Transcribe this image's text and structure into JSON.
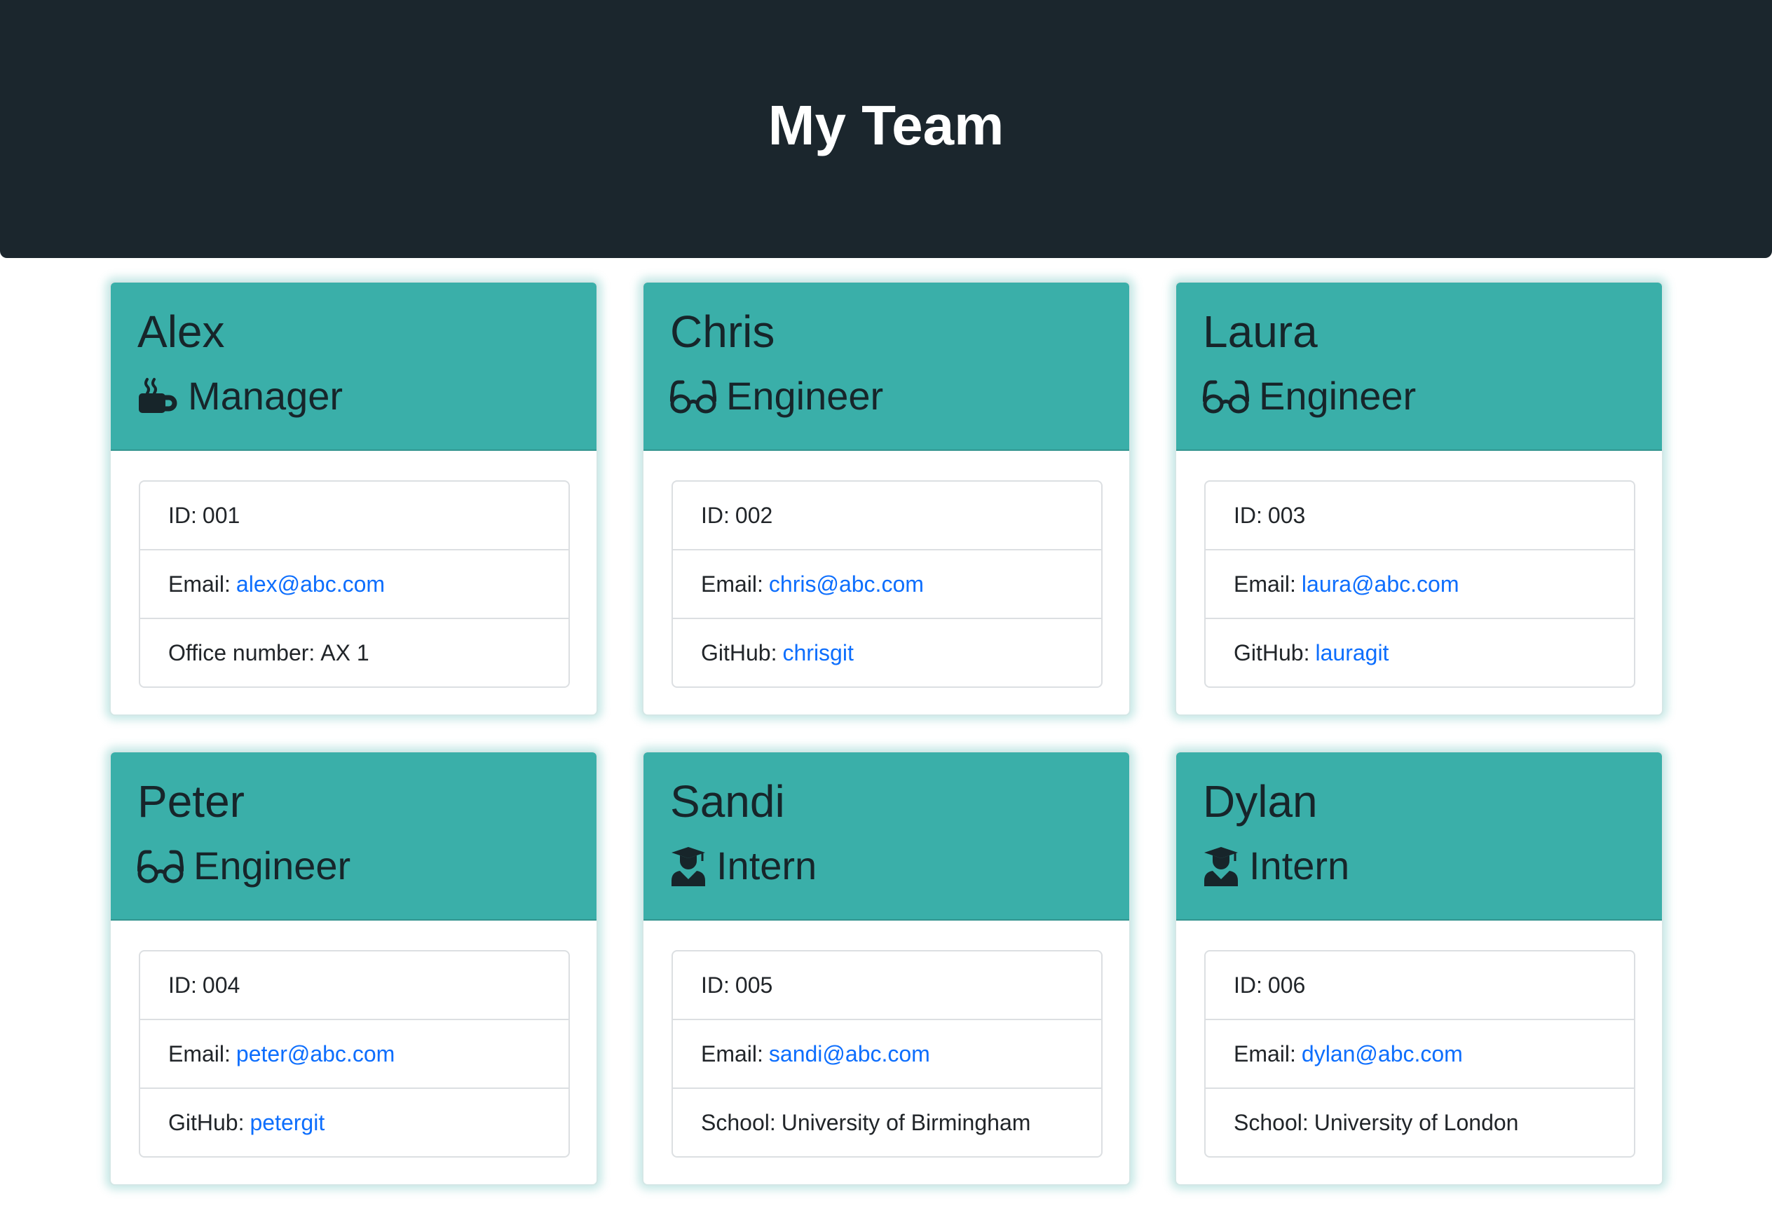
{
  "header": {
    "title": "My Team"
  },
  "colors": {
    "header_bg": "#1b262d",
    "card_head_bg": "#3aafa9",
    "link": "#0d6efd"
  },
  "cards": [
    {
      "name": "Alex",
      "role": "Manager",
      "role_icon": "coffee-mug-icon",
      "id_label": "ID:",
      "id": "001",
      "email_label": "Email:",
      "email": "alex@abc.com",
      "extra_label": "Office number:",
      "extra": "AX 1"
    },
    {
      "name": "Chris",
      "role": "Engineer",
      "role_icon": "glasses-icon",
      "id_label": "ID:",
      "id": "002",
      "email_label": "Email:",
      "email": "chris@abc.com",
      "extra_label": "GitHub:",
      "extra": "chrisgit"
    },
    {
      "name": "Laura",
      "role": "Engineer",
      "role_icon": "glasses-icon",
      "id_label": "ID:",
      "id": "003",
      "email_label": "Email:",
      "email": "laura@abc.com",
      "extra_label": "GitHub:",
      "extra": "lauragit"
    },
    {
      "name": "Peter",
      "role": "Engineer",
      "role_icon": "glasses-icon",
      "id_label": "ID:",
      "id": "004",
      "email_label": "Email:",
      "email": "peter@abc.com",
      "extra_label": "GitHub:",
      "extra": "petergit"
    },
    {
      "name": "Sandi",
      "role": "Intern",
      "role_icon": "graduate-icon",
      "id_label": "ID:",
      "id": "005",
      "email_label": "Email:",
      "email": "sandi@abc.com",
      "extra_label": "School:",
      "extra": "University of Birmingham"
    },
    {
      "name": "Dylan",
      "role": "Intern",
      "role_icon": "graduate-icon",
      "id_label": "ID:",
      "id": "006",
      "email_label": "Email:",
      "email": "dylan@abc.com",
      "extra_label": "School:",
      "extra": "University of London"
    }
  ]
}
